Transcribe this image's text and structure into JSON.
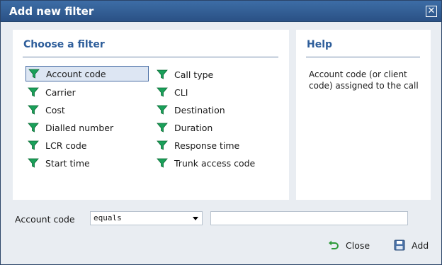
{
  "dialog": {
    "title": "Add new filter",
    "close_icon": "close-x-icon"
  },
  "filters_panel": {
    "title": "Choose a filter",
    "items": [
      {
        "label": "Account code",
        "selected": true
      },
      {
        "label": "Carrier"
      },
      {
        "label": "Cost"
      },
      {
        "label": "Dialled number"
      },
      {
        "label": "LCR code"
      },
      {
        "label": "Start time"
      },
      {
        "label": "Call type"
      },
      {
        "label": "CLI"
      },
      {
        "label": "Destination"
      },
      {
        "label": "Duration"
      },
      {
        "label": "Response time"
      },
      {
        "label": "Trunk access code"
      }
    ],
    "item_icon": "funnel-icon",
    "icon_color": "#1aa05a"
  },
  "help_panel": {
    "title": "Help",
    "text": "Account code (or client code) assigned to the call"
  },
  "condition": {
    "label": "Account code",
    "operator": "equals",
    "value": ""
  },
  "buttons": {
    "close_label": "Close",
    "add_label": "Add"
  },
  "colors": {
    "titlebar": "#2f5b92",
    "panel_heading": "#2d5d9a",
    "selected_bg": "#dde6f3"
  }
}
